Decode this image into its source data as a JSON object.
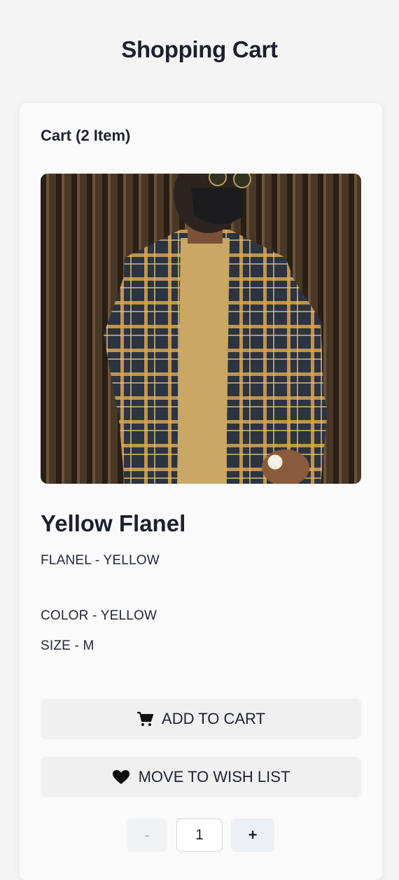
{
  "page": {
    "title": "Shopping Cart"
  },
  "cart": {
    "count_label": "Cart (2 Item)",
    "item": {
      "name": "Yellow Flanel",
      "variant": "FLANEL - YELLOW",
      "color": "COLOR - YELLOW",
      "size": "SIZE - M",
      "image_icon": "product-photo"
    },
    "actions": {
      "add_to_cart": "ADD TO CART",
      "add_to_cart_icon": "cart-icon",
      "move_to_wishlist": "MOVE TO WISH LIST",
      "move_to_wishlist_icon": "heart-icon"
    },
    "quantity": {
      "value": "1",
      "decrement": "-",
      "increment": "+"
    }
  }
}
